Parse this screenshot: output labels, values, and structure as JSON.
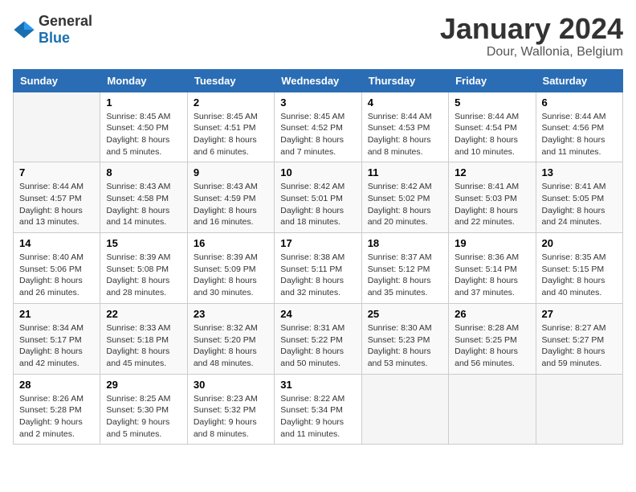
{
  "header": {
    "logo_general": "General",
    "logo_blue": "Blue",
    "month_title": "January 2024",
    "location": "Dour, Wallonia, Belgium"
  },
  "calendar": {
    "days_of_week": [
      "Sunday",
      "Monday",
      "Tuesday",
      "Wednesday",
      "Thursday",
      "Friday",
      "Saturday"
    ],
    "weeks": [
      [
        {
          "day": "",
          "info": ""
        },
        {
          "day": "1",
          "info": "Sunrise: 8:45 AM\nSunset: 4:50 PM\nDaylight: 8 hours\nand 5 minutes."
        },
        {
          "day": "2",
          "info": "Sunrise: 8:45 AM\nSunset: 4:51 PM\nDaylight: 8 hours\nand 6 minutes."
        },
        {
          "day": "3",
          "info": "Sunrise: 8:45 AM\nSunset: 4:52 PM\nDaylight: 8 hours\nand 7 minutes."
        },
        {
          "day": "4",
          "info": "Sunrise: 8:44 AM\nSunset: 4:53 PM\nDaylight: 8 hours\nand 8 minutes."
        },
        {
          "day": "5",
          "info": "Sunrise: 8:44 AM\nSunset: 4:54 PM\nDaylight: 8 hours\nand 10 minutes."
        },
        {
          "day": "6",
          "info": "Sunrise: 8:44 AM\nSunset: 4:56 PM\nDaylight: 8 hours\nand 11 minutes."
        }
      ],
      [
        {
          "day": "7",
          "info": "Sunrise: 8:44 AM\nSunset: 4:57 PM\nDaylight: 8 hours\nand 13 minutes."
        },
        {
          "day": "8",
          "info": "Sunrise: 8:43 AM\nSunset: 4:58 PM\nDaylight: 8 hours\nand 14 minutes."
        },
        {
          "day": "9",
          "info": "Sunrise: 8:43 AM\nSunset: 4:59 PM\nDaylight: 8 hours\nand 16 minutes."
        },
        {
          "day": "10",
          "info": "Sunrise: 8:42 AM\nSunset: 5:01 PM\nDaylight: 8 hours\nand 18 minutes."
        },
        {
          "day": "11",
          "info": "Sunrise: 8:42 AM\nSunset: 5:02 PM\nDaylight: 8 hours\nand 20 minutes."
        },
        {
          "day": "12",
          "info": "Sunrise: 8:41 AM\nSunset: 5:03 PM\nDaylight: 8 hours\nand 22 minutes."
        },
        {
          "day": "13",
          "info": "Sunrise: 8:41 AM\nSunset: 5:05 PM\nDaylight: 8 hours\nand 24 minutes."
        }
      ],
      [
        {
          "day": "14",
          "info": "Sunrise: 8:40 AM\nSunset: 5:06 PM\nDaylight: 8 hours\nand 26 minutes."
        },
        {
          "day": "15",
          "info": "Sunrise: 8:39 AM\nSunset: 5:08 PM\nDaylight: 8 hours\nand 28 minutes."
        },
        {
          "day": "16",
          "info": "Sunrise: 8:39 AM\nSunset: 5:09 PM\nDaylight: 8 hours\nand 30 minutes."
        },
        {
          "day": "17",
          "info": "Sunrise: 8:38 AM\nSunset: 5:11 PM\nDaylight: 8 hours\nand 32 minutes."
        },
        {
          "day": "18",
          "info": "Sunrise: 8:37 AM\nSunset: 5:12 PM\nDaylight: 8 hours\nand 35 minutes."
        },
        {
          "day": "19",
          "info": "Sunrise: 8:36 AM\nSunset: 5:14 PM\nDaylight: 8 hours\nand 37 minutes."
        },
        {
          "day": "20",
          "info": "Sunrise: 8:35 AM\nSunset: 5:15 PM\nDaylight: 8 hours\nand 40 minutes."
        }
      ],
      [
        {
          "day": "21",
          "info": "Sunrise: 8:34 AM\nSunset: 5:17 PM\nDaylight: 8 hours\nand 42 minutes."
        },
        {
          "day": "22",
          "info": "Sunrise: 8:33 AM\nSunset: 5:18 PM\nDaylight: 8 hours\nand 45 minutes."
        },
        {
          "day": "23",
          "info": "Sunrise: 8:32 AM\nSunset: 5:20 PM\nDaylight: 8 hours\nand 48 minutes."
        },
        {
          "day": "24",
          "info": "Sunrise: 8:31 AM\nSunset: 5:22 PM\nDaylight: 8 hours\nand 50 minutes."
        },
        {
          "day": "25",
          "info": "Sunrise: 8:30 AM\nSunset: 5:23 PM\nDaylight: 8 hours\nand 53 minutes."
        },
        {
          "day": "26",
          "info": "Sunrise: 8:28 AM\nSunset: 5:25 PM\nDaylight: 8 hours\nand 56 minutes."
        },
        {
          "day": "27",
          "info": "Sunrise: 8:27 AM\nSunset: 5:27 PM\nDaylight: 8 hours\nand 59 minutes."
        }
      ],
      [
        {
          "day": "28",
          "info": "Sunrise: 8:26 AM\nSunset: 5:28 PM\nDaylight: 9 hours\nand 2 minutes."
        },
        {
          "day": "29",
          "info": "Sunrise: 8:25 AM\nSunset: 5:30 PM\nDaylight: 9 hours\nand 5 minutes."
        },
        {
          "day": "30",
          "info": "Sunrise: 8:23 AM\nSunset: 5:32 PM\nDaylight: 9 hours\nand 8 minutes."
        },
        {
          "day": "31",
          "info": "Sunrise: 8:22 AM\nSunset: 5:34 PM\nDaylight: 9 hours\nand 11 minutes."
        },
        {
          "day": "",
          "info": ""
        },
        {
          "day": "",
          "info": ""
        },
        {
          "day": "",
          "info": ""
        }
      ]
    ]
  }
}
